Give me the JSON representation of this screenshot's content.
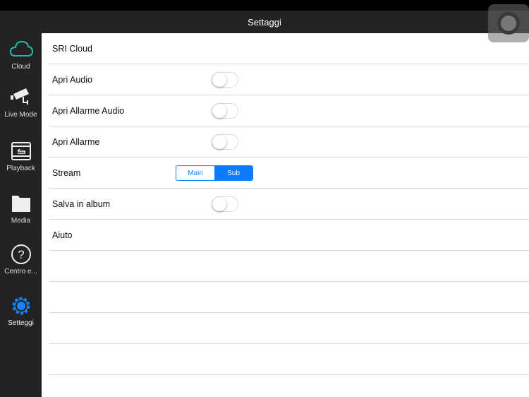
{
  "header": {
    "title": "Settaggi"
  },
  "sidebar": {
    "items": [
      {
        "label": "Cloud",
        "icon": "cloud-icon"
      },
      {
        "label": "Live Mode",
        "icon": "camera-icon"
      },
      {
        "label": "Playback",
        "icon": "playback-icon"
      },
      {
        "label": "Media",
        "icon": "folder-icon"
      },
      {
        "label": "Centro e...",
        "icon": "help-icon"
      },
      {
        "label": "Setteggi",
        "icon": "gear-icon",
        "active": true
      }
    ]
  },
  "settings": {
    "sri_cloud": "SRI Cloud",
    "apri_audio": {
      "label": "Apri Audio",
      "on": false
    },
    "apri_allarme_audio": {
      "label": "Apri Allarme Audio",
      "on": false
    },
    "apri_allarme": {
      "label": "Apri Allarme",
      "on": false
    },
    "stream": {
      "label": "Stream",
      "options": [
        "Main",
        "Sub"
      ],
      "selected": "Sub"
    },
    "salva_album": {
      "label": "Salva in album",
      "on": false
    },
    "aiuto": "Aiuto"
  },
  "colors": {
    "accent": "#0a7afe",
    "cloud": "#2bb5b0",
    "bar": "#232323"
  }
}
